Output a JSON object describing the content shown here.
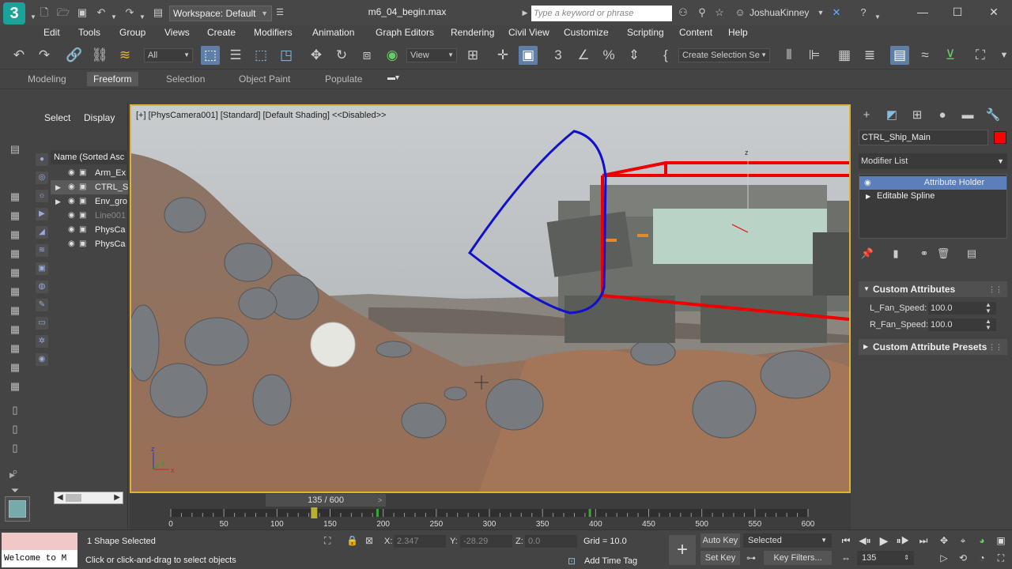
{
  "title_bar": {
    "logo_text": "3",
    "workspace_label": "Workspace: Default",
    "filename": "m6_04_begin.max",
    "search_placeholder": "Type a keyword or phrase",
    "username": "JoshuaKinney"
  },
  "menu": [
    "Edit",
    "Tools",
    "Group",
    "Views",
    "Create",
    "Modifiers",
    "Animation",
    "Graph Editors",
    "Rendering",
    "Civil View",
    "Customize",
    "Scripting",
    "Content",
    "Help"
  ],
  "toolbar": {
    "selection_filter": "All",
    "ref_coord": "View",
    "named_selection": "Create Selection Se"
  },
  "ribbon_tabs": [
    "Modeling",
    "Freeform",
    "Selection",
    "Object Paint",
    "Populate"
  ],
  "ribbon_active": "Freeform",
  "scene_explorer": {
    "tabs": [
      "Select",
      "Display"
    ],
    "header": "Name (Sorted Asc",
    "rows": [
      {
        "label": "Arm_Ex",
        "expand": "",
        "selected": false,
        "dim": false
      },
      {
        "label": "CTRL_S",
        "expand": "▶",
        "selected": true,
        "dim": false
      },
      {
        "label": "Env_gro",
        "expand": "▶",
        "selected": false,
        "dim": false
      },
      {
        "label": "Line001",
        "expand": "",
        "selected": false,
        "dim": true
      },
      {
        "label": "PhysCa",
        "expand": "",
        "selected": false,
        "dim": false
      },
      {
        "label": "PhysCa",
        "expand": "",
        "selected": false,
        "dim": false
      }
    ]
  },
  "viewport": {
    "label": "[+] [PhysCamera001] [Standard] [Default Shading]  <<Disabled>>",
    "axis_labels": [
      "x",
      "y",
      "z"
    ]
  },
  "command_panel": {
    "object_name": "CTRL_Ship_Main",
    "object_color": "#ff0000",
    "modifier_list": "Modifier List",
    "stack": [
      {
        "label": "Attribute Holder",
        "selected": true
      },
      {
        "label": "Editable Spline",
        "selected": false
      }
    ],
    "rollouts": {
      "custom_attributes": "Custom Attributes",
      "presets": "Custom Attribute Presets"
    },
    "params": [
      {
        "label": "L_Fan_Speed:",
        "value": "100.0"
      },
      {
        "label": "R_Fan_Speed:",
        "value": "100.0"
      }
    ]
  },
  "timeline": {
    "frame_display": "135 / 600",
    "current_frame": 135,
    "total_frames": 600,
    "ticks": [
      "0",
      "50",
      "100",
      "150",
      "200",
      "250",
      "300",
      "350",
      "400",
      "450",
      "500",
      "550",
      "600"
    ]
  },
  "status": {
    "selection": "1 Shape Selected",
    "prompt": "Click or click-and-drag to select objects",
    "maxscript": "Welcome to M",
    "x_label": "X:",
    "x_value": "2.347",
    "y_label": "Y:",
    "y_value": "-28.29",
    "z_label": "Z:",
    "z_value": "0.0",
    "grid": "Grid = 10.0",
    "add_time_tag": "Add Time Tag",
    "auto_key": "Auto Key",
    "set_key": "Set Key",
    "key_mode": "Selected",
    "key_filters": "Key Filters...",
    "frame_field": "135"
  }
}
